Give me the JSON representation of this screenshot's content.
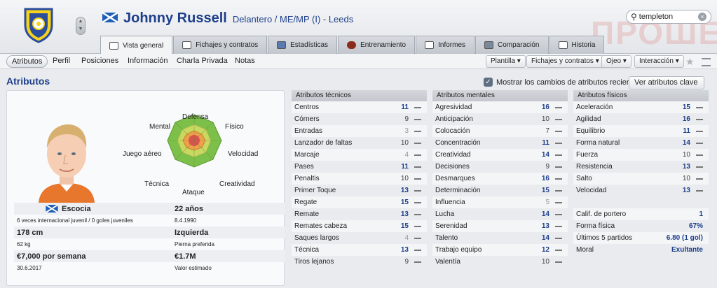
{
  "player": {
    "name": "Johnny Russell",
    "position_club": "Delantero / ME/MP (I) - Leeds"
  },
  "watermark": "ПРОШЕ",
  "search": {
    "value": "templeton"
  },
  "tabs": [
    {
      "label": "Vista general",
      "active": true
    },
    {
      "label": "Fichajes y contratos"
    },
    {
      "label": "Estadísticas"
    },
    {
      "label": "Entrenamiento"
    },
    {
      "label": "Informes"
    },
    {
      "label": "Comparación"
    },
    {
      "label": "Historia"
    }
  ],
  "subnav": [
    "Atributos",
    "Perfil",
    "Posiciones",
    "Información",
    "Charla Privada",
    "Notas"
  ],
  "dropdowns": [
    "Plantilla",
    "Fichajes y contratos",
    "Ojeo",
    "Interacción"
  ],
  "section_title": "Atributos",
  "show_changes": {
    "label": "Mostrar los cambios de atributos recientes",
    "checked": true
  },
  "key_attrs_button": "Ver atributos clave",
  "radar_labels": {
    "defensa": "Defensa",
    "mental": "Mental",
    "fisico": "Físico",
    "juego_aereo": "Juego aéreo",
    "velocidad": "Velocidad",
    "tecnica": "Técnica",
    "creatividad": "Creatividad",
    "ataque": "Ataque"
  },
  "info": {
    "nationality": "Escocia",
    "age": "22 años",
    "caps": "6 veces internacional juvenil / 0 goles juveniles",
    "dob": "8.4.1990",
    "height": "178 cm",
    "foot": "Izquierda",
    "weight": "62 kg",
    "foot_label": "Pierna preferida",
    "wage": "€7,000 por semana",
    "value": "€1.7M",
    "contract_end": "30.6.2017",
    "value_label": "Valor estimado"
  },
  "technical": {
    "title": "Atributos técnicos",
    "items": [
      {
        "name": "Centros",
        "value": "11"
      },
      {
        "name": "Córners",
        "value": "9"
      },
      {
        "name": "Entradas",
        "value": "3"
      },
      {
        "name": "Lanzador de faltas",
        "value": "10"
      },
      {
        "name": "Marcaje",
        "value": "4"
      },
      {
        "name": "Pases",
        "value": "11"
      },
      {
        "name": "Penaltis",
        "value": "10"
      },
      {
        "name": "Primer Toque",
        "value": "13"
      },
      {
        "name": "Regate",
        "value": "15"
      },
      {
        "name": "Remate",
        "value": "13"
      },
      {
        "name": "Remates cabeza",
        "value": "15"
      },
      {
        "name": "Saques largos",
        "value": "4"
      },
      {
        "name": "Técnica",
        "value": "13"
      },
      {
        "name": "Tiros lejanos",
        "value": "9"
      }
    ]
  },
  "mental": {
    "title": "Atributos mentales",
    "items": [
      {
        "name": "Agresividad",
        "value": "16"
      },
      {
        "name": "Anticipación",
        "value": "10"
      },
      {
        "name": "Colocación",
        "value": "7"
      },
      {
        "name": "Concentración",
        "value": "11"
      },
      {
        "name": "Creatividad",
        "value": "14"
      },
      {
        "name": "Decisiones",
        "value": "9"
      },
      {
        "name": "Desmarques",
        "value": "16"
      },
      {
        "name": "Determinación",
        "value": "15"
      },
      {
        "name": "Influencia",
        "value": "5"
      },
      {
        "name": "Lucha",
        "value": "14"
      },
      {
        "name": "Serenidad",
        "value": "13"
      },
      {
        "name": "Talento",
        "value": "14"
      },
      {
        "name": "Trabajo equipo",
        "value": "12"
      },
      {
        "name": "Valentía",
        "value": "10"
      }
    ]
  },
  "physical": {
    "title": "Atributos físicos",
    "items": [
      {
        "name": "Aceleración",
        "value": "15"
      },
      {
        "name": "Agilidad",
        "value": "16"
      },
      {
        "name": "Equilibrio",
        "value": "11"
      },
      {
        "name": "Forma natural",
        "value": "14"
      },
      {
        "name": "Fuerza",
        "value": "10"
      },
      {
        "name": "Resistencia",
        "value": "13"
      },
      {
        "name": "Salto",
        "value": "10"
      },
      {
        "name": "Velocidad",
        "value": "13"
      }
    ],
    "extra": [
      {
        "name": "Calif. de portero",
        "value": "1"
      },
      {
        "name": "Forma física",
        "value": "67%"
      },
      {
        "name": "Últimos 5 partidos",
        "value": "6.80 (1 gol)"
      },
      {
        "name": "Moral",
        "value": "Exultante"
      }
    ]
  },
  "colors": {
    "accent": "#1d3f8a",
    "radar_green": "#7cc04a",
    "radar_red": "#e0504f"
  }
}
